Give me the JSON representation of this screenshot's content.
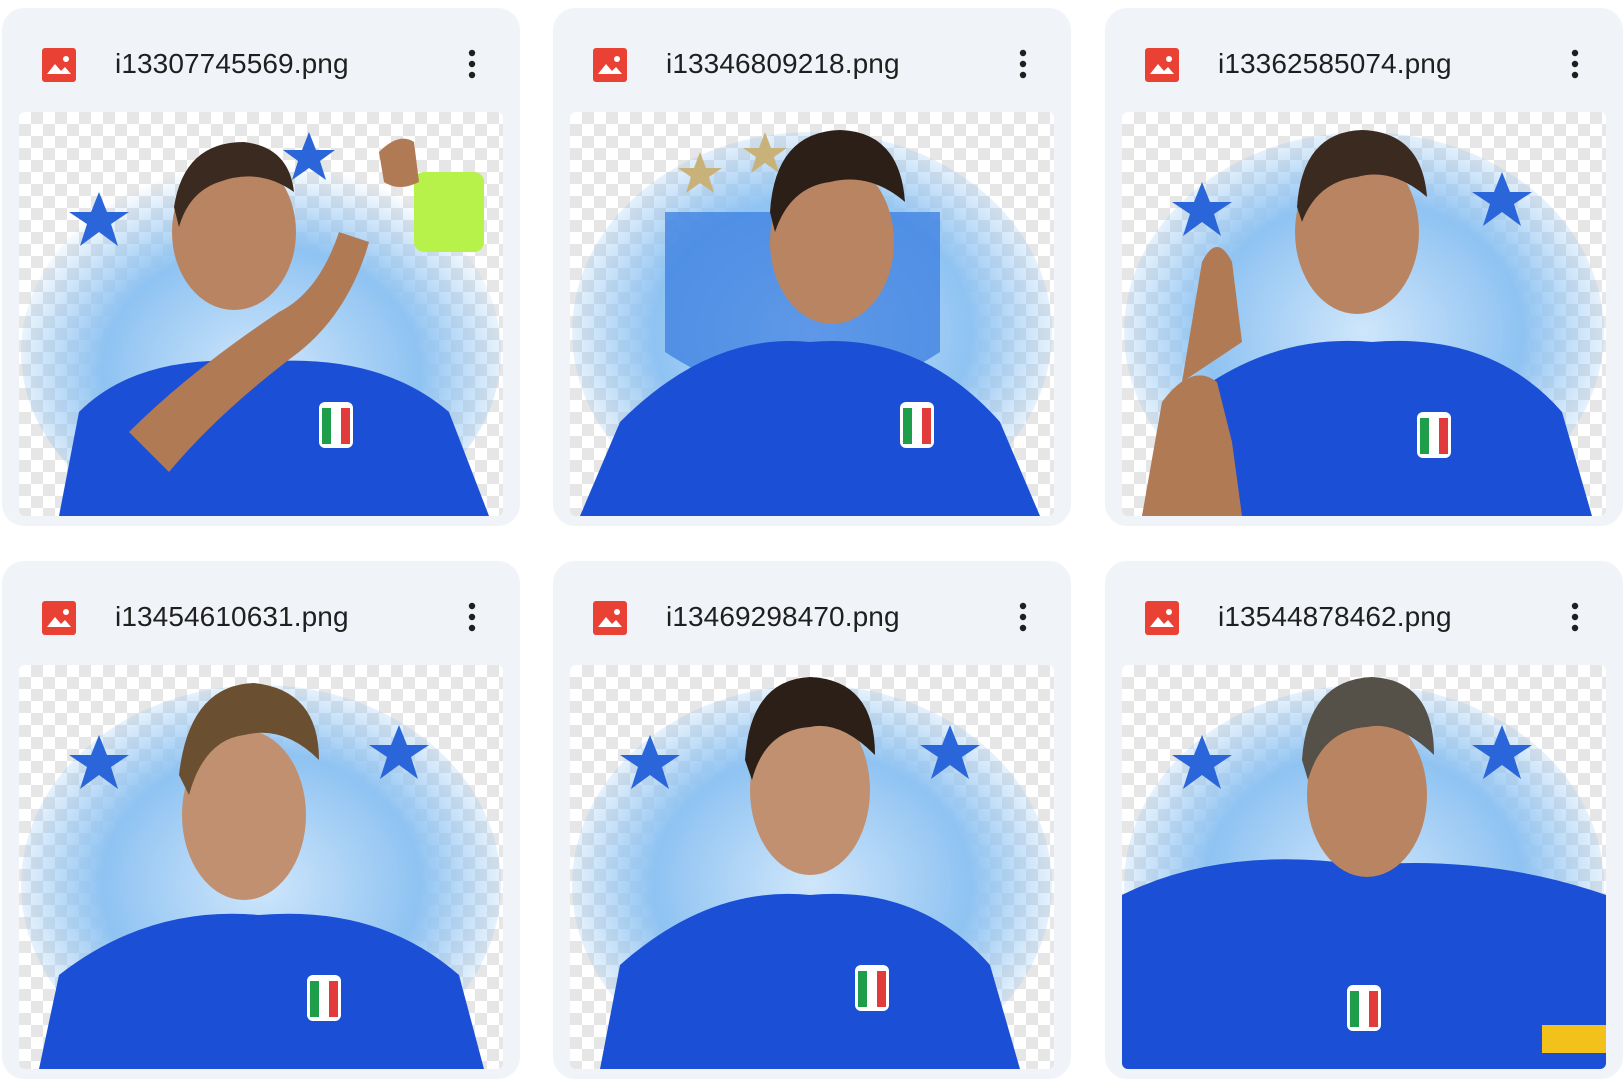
{
  "files": [
    {
      "name": "i13307745569.png",
      "type_icon": "image-file-icon",
      "menu_icon": "more-vert-icon"
    },
    {
      "name": "i13346809218.png",
      "type_icon": "image-file-icon",
      "menu_icon": "more-vert-icon"
    },
    {
      "name": "i13362585074.png",
      "type_icon": "image-file-icon",
      "menu_icon": "more-vert-icon"
    },
    {
      "name": "i13454610631.png",
      "type_icon": "image-file-icon",
      "menu_icon": "more-vert-icon"
    },
    {
      "name": "i13469298470.png",
      "type_icon": "image-file-icon",
      "menu_icon": "more-vert-icon"
    },
    {
      "name": "i13544878462.png",
      "type_icon": "image-file-icon",
      "menu_icon": "more-vert-icon"
    }
  ],
  "colors": {
    "card_bg": "#f0f4f9",
    "image_icon": "#e94235",
    "text": "#1f1f1f",
    "jersey_blue": "#1a4fd6",
    "glow_blue": "#8fc3f2"
  }
}
